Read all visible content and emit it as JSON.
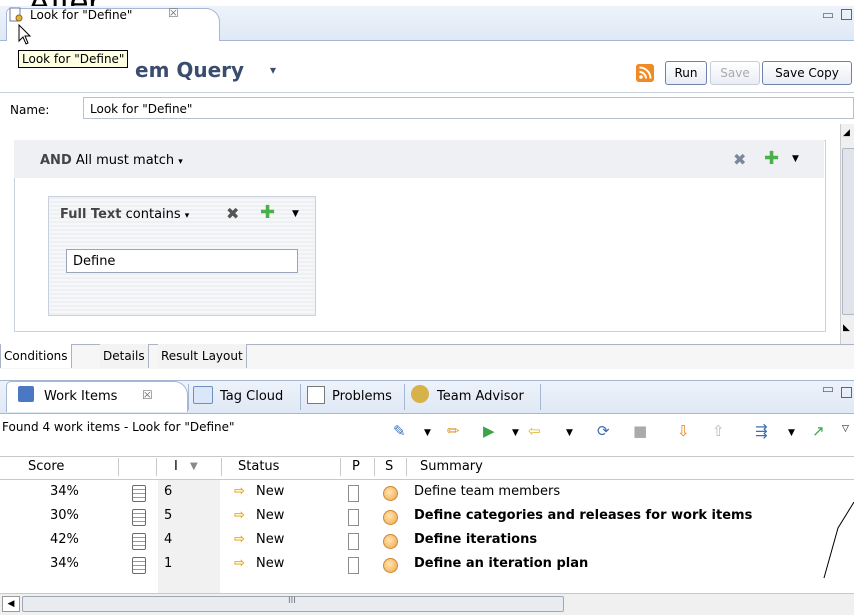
{
  "overlay": {
    "title": "After"
  },
  "editor": {
    "tab_label": "Look for \"Define\"",
    "tab_close": "☒",
    "tooltip": "Look for \"Define\"",
    "query_title": "em Query",
    "query_title_arrow": "▾",
    "buttons": {
      "run": "Run",
      "save": "Save",
      "save_copy": "Save Copy"
    },
    "name_label": "Name:",
    "name_value": "Look for \"Define\"",
    "and_group": {
      "keyword": "AND",
      "text": "All must match",
      "arrow": "▾"
    },
    "full_text": {
      "keyword": "Full Text",
      "operator": "contains",
      "arrow": "▾",
      "value": "Define"
    },
    "bottom_tabs": [
      "Conditions",
      "Details",
      "Result Layout"
    ]
  },
  "view": {
    "tabs": [
      {
        "label": "Work Items",
        "close": "☒"
      },
      {
        "label": "Tag Cloud"
      },
      {
        "label": "Problems"
      },
      {
        "label": "Team Advisor"
      }
    ],
    "found_text": "Found 4 work items - Look for \"Define\"",
    "columns": {
      "score": "Score",
      "id": "I",
      "id_sort": "▼",
      "status": "Status",
      "p": "P",
      "s": "S",
      "summary": "Summary"
    },
    "rows": [
      {
        "score": "34%",
        "id": "6",
        "status": "New",
        "summary": "Define team members",
        "bold": false
      },
      {
        "score": "30%",
        "id": "5",
        "status": "New",
        "summary": "Define categories and releases for work items",
        "bold": true
      },
      {
        "score": "42%",
        "id": "4",
        "status": "New",
        "summary": "Define iterations",
        "bold": true
      },
      {
        "score": "34%",
        "id": "1",
        "status": "New",
        "summary": "Define an iteration plan",
        "bold": true
      }
    ],
    "status_arrow": "⇨",
    "hscroll_grip": "III"
  },
  "colors": {
    "accent": "#3b4d6e",
    "plus": "#49b04a",
    "new_arrow": "#e7a200"
  }
}
